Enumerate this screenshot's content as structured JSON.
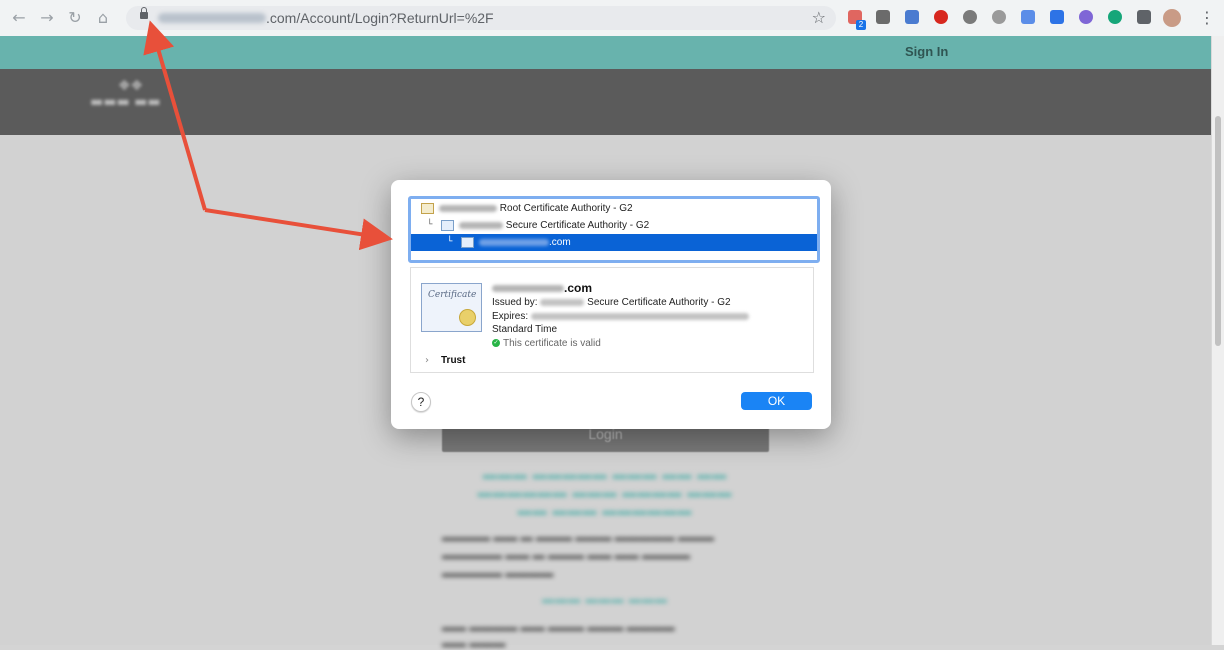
{
  "browser": {
    "url_visible": ".com/Account/Login?ReturnUrl=%2F",
    "extension_badge": "2"
  },
  "site": {
    "signin_label": "Sign In",
    "login_button": "Login"
  },
  "dialog": {
    "chain": [
      {
        "suffix": "Root Certificate Authority - G2"
      },
      {
        "suffix": "Secure Certificate Authority - G2"
      },
      {
        "suffix": ".com"
      }
    ],
    "cert_icon_text": "Certificate",
    "detail": {
      "title_suffix": ".com",
      "issued_label": "Issued by:",
      "issued_suffix": "Secure Certificate Authority - G2",
      "expires_label": "Expires:",
      "expires_tail": "Standard Time",
      "valid_text": "This certificate is valid"
    },
    "trust_label": "Trust",
    "help_label": "?",
    "ok_label": "OK"
  },
  "colors": {
    "teal": "#68b3ad",
    "selection": "#0a63d6",
    "ok": "#1a84f5",
    "arrow": "#e8503a"
  }
}
